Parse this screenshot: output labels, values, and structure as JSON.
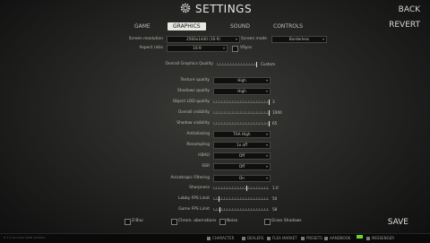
{
  "header": {
    "title": "SETTINGS",
    "back": "BACK",
    "revert": "REVERT",
    "save": "SAVE"
  },
  "tabs": [
    {
      "label": "GAME",
      "active": false
    },
    {
      "label": "GRAPHICS",
      "active": true
    },
    {
      "label": "SOUND",
      "active": false
    },
    {
      "label": "CONTROLS",
      "active": false
    }
  ],
  "top": {
    "screen_resolution": {
      "label": "Screen resolution",
      "value": "2560x1440 (16:9)"
    },
    "aspect_ratio": {
      "label": "Aspect ratio",
      "value": "16:9"
    },
    "screen_mode": {
      "label": "Screen mode",
      "value": "Borderless"
    },
    "vsync": {
      "label": "VSync",
      "checked": false
    },
    "overall_quality": {
      "label": "Overall Graphics Quality",
      "value": "Custom"
    }
  },
  "settings": [
    {
      "label": "Texture quality",
      "kind": "select",
      "value": "High"
    },
    {
      "label": "Shadows quality",
      "kind": "select",
      "value": "High"
    },
    {
      "label": "Object LOD quality",
      "kind": "slider",
      "value": "3",
      "fraction": 1.0
    },
    {
      "label": "Overall visibility",
      "kind": "slider",
      "value": "1000",
      "fraction": 1.0
    },
    {
      "label": "Shadow visibility",
      "kind": "slider",
      "value": "65",
      "fraction": 1.0
    },
    {
      "label": "Antialiasing",
      "kind": "select",
      "value": "TAA High"
    },
    {
      "label": "Resampling",
      "kind": "select",
      "value": "1x off"
    },
    {
      "label": "HBAO",
      "kind": "select",
      "value": "Off"
    },
    {
      "label": "SSR",
      "kind": "select",
      "value": "Off"
    },
    {
      "label": "Anisotropic Filtering",
      "kind": "select",
      "value": "On"
    },
    {
      "label": "Sharpness",
      "kind": "slider",
      "value": "1.0",
      "fraction": 0.6
    },
    {
      "label": "Lobby FPS Limit",
      "kind": "slider",
      "value": "50",
      "fraction": 0.1
    },
    {
      "label": "Game FPS Limit",
      "kind": "slider",
      "value": "58",
      "fraction": 0.12
    }
  ],
  "checkboxes": [
    {
      "label": "Z-Blur",
      "checked": false
    },
    {
      "label": "Chrom. aberrations",
      "checked": false
    },
    {
      "label": "Noise",
      "checked": false
    },
    {
      "label": "Grass Shadows",
      "checked": false
    }
  ],
  "bottom_bar": {
    "version": "0.12.xx.xxxx beta version",
    "items": [
      {
        "label": "CHARACTER",
        "icon": "character-icon"
      },
      {
        "label": "DEALERS",
        "icon": "dealers-icon"
      },
      {
        "label": "FLEA MARKET",
        "icon": "flea-market-icon"
      },
      {
        "label": "PRESETS",
        "icon": "presets-icon"
      },
      {
        "label": "HANDBOOK",
        "icon": "handbook-icon"
      },
      {
        "label": "MESSENGER",
        "icon": "messenger-icon"
      }
    ]
  }
}
